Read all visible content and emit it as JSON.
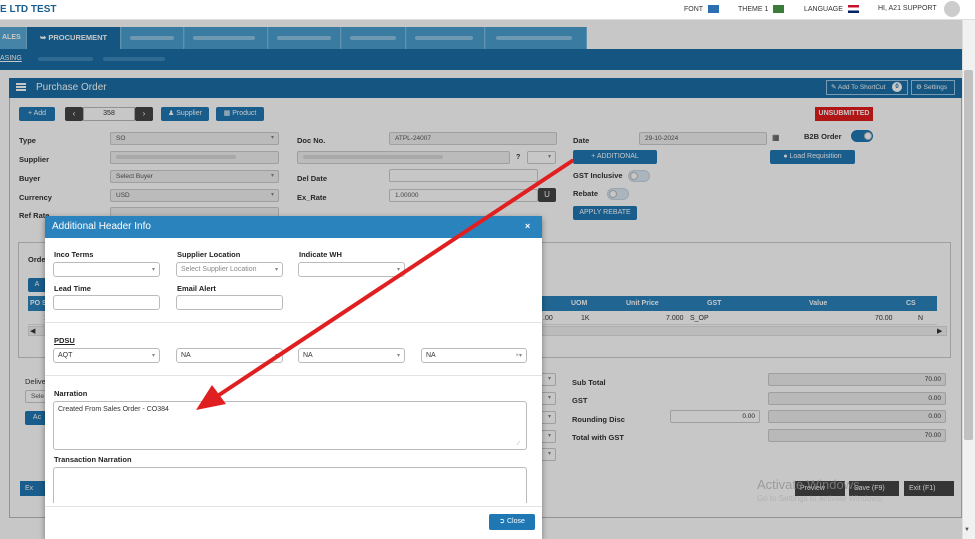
{
  "topbar": {
    "brand": "E LTD TEST",
    "font_label": "FONT",
    "theme_label": "THEME 1",
    "language_label": "LANGUAGE",
    "user_label": "HI, A21 SUPPORT"
  },
  "nav": {
    "sales_label": "ALES",
    "procurement_label": "PROCUREMENT",
    "sub_purchasing": "ASING"
  },
  "panel": {
    "title": "Purchase Order",
    "shortcut_label": "Add To ShortCut",
    "shortcut_count": "0",
    "settings_label": "Settings"
  },
  "toolbar": {
    "add_label": "Add",
    "record_number": "358",
    "supplier_label": "Supplier",
    "product_label": "Product",
    "status": "UNSUBMITTED"
  },
  "form": {
    "type_label": "Type",
    "type_value": "SO",
    "supplier_label": "Supplier",
    "buyer_label": "Buyer",
    "buyer_placeholder": "Select Buyer",
    "currency_label": "Currency",
    "currency_value": "USD",
    "refrate_label": "Ref Rate",
    "docno_label": "Doc No.",
    "docno_value": "ATPL-24007",
    "question_mark": "?",
    "deldate_label": "Del Date",
    "exrate_label": "Ex_Rate",
    "exrate_value": "1.00000",
    "u_button": "U",
    "date_label": "Date",
    "date_value": "29-10-2024",
    "b2b_label": "B2B Order",
    "additional_label": "ADDITIONAL",
    "load_requisition_label": "Load Requisition",
    "gst_inclusive_label": "GST Inclusive",
    "rebate_label": "Rebate",
    "apply_rebate_label": "APPLY REBATE"
  },
  "grid": {
    "orders_tab": "Orde",
    "add_short": "A",
    "po_header": "PO S",
    "columns": [
      "UOM",
      "Unit Price",
      "GST",
      "Value",
      "CS"
    ],
    "row": {
      "qty_frag": ".00",
      "uom": "1K",
      "unit_price": "7.000",
      "gst": "S_OP",
      "value": "70.00",
      "cs": "N"
    },
    "first_cell": "1"
  },
  "totals": {
    "delivery_label": "Delive",
    "select_frag": "Sele",
    "action_frag": "Ac",
    "subtotal_label": "Sub Total",
    "subtotal_value": "70.00",
    "gst_label": "GST",
    "gst_value": "0.00",
    "rounding_label": "Rounding Disc",
    "rounding_input": "0.00",
    "rounding_value": "0.00",
    "total_label": "Total with GST",
    "total_value": "70.00"
  },
  "footer_buttons": {
    "left_frag": "Ex",
    "preview_frag": "Preview",
    "save_label": "Save (F9)",
    "exit_label": "Exit (F1)"
  },
  "watermark": {
    "line1": "Activate Windows",
    "line2": "Go to Settings to activate Windows."
  },
  "modal": {
    "title": "Additional Header Info",
    "close_x": "×",
    "inco_terms_label": "Inco Terms",
    "supplier_location_label": "Supplier Location",
    "supplier_location_placeholder": "Select Supplier Location",
    "indicate_wh_label": "Indicate WH",
    "lead_time_label": "Lead Time",
    "email_alert_label": "Email Alert",
    "pdsu_label": "PDSU",
    "pdsu_values": [
      "AQT",
      "NA",
      "NA",
      "NA"
    ],
    "narration_label": "Narration",
    "narration_value": "Created From Sales Order - CO384",
    "transaction_narration_label": "Transaction Narration",
    "close_button": "Close"
  },
  "colors": {
    "primary": "#1f78b4",
    "header": "#1a6fa6",
    "status_red": "#e21d1d",
    "arrow_red": "#e02020"
  }
}
